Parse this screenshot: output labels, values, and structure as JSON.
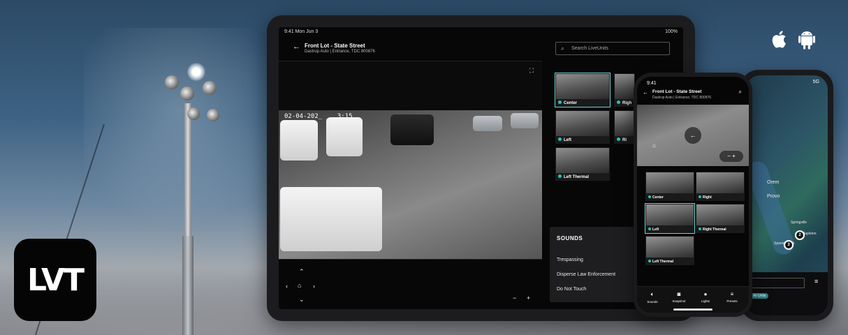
{
  "brand": {
    "logo_text": "LVT"
  },
  "platforms": [
    "apple-icon",
    "android-icon"
  ],
  "tablet": {
    "status_time": "9:41  Mon Jun 3",
    "status_battery": "100%",
    "title": "Front Lot - State Street",
    "subtitle": "Dastrup Auto | Entrance, TDC 800876",
    "search_placeholder": "Search LiveUnits",
    "timestamp": "02-04-202_ _ _3:15",
    "cameras": [
      {
        "label": "Center",
        "status": true
      },
      {
        "label": "Righ",
        "status": true
      },
      {
        "label": "Left",
        "status": true
      },
      {
        "label": "Ri",
        "status": true
      },
      {
        "label": "Left Thermal",
        "status": true
      }
    ],
    "sounds": {
      "heading": "SOUNDS",
      "options": [
        "Trespassing",
        "Disperse Law Enforcement",
        "Do Not Touch"
      ]
    }
  },
  "phone": {
    "status_time": "9:41",
    "title": "Front Lot - State Street",
    "subtitle": "Dastrup Auto | Entrance, TDC 800876",
    "cameras": [
      {
        "label": "Center"
      },
      {
        "label": "Right"
      },
      {
        "label": "Left"
      },
      {
        "label": "Right Thermal"
      },
      {
        "label": "Left Thermal"
      }
    ],
    "tabs": [
      "Sounds",
      "Snapshot",
      "Lights",
      "Presets"
    ]
  },
  "map_phone": {
    "status": "5G",
    "labels": [
      "Orem",
      "Provo",
      "Springville",
      "Mapleton",
      "Spanish Fork"
    ],
    "pins": [
      "2",
      "3"
    ],
    "chip": "All Units"
  },
  "colors": {
    "accent": "#27c3c0"
  }
}
